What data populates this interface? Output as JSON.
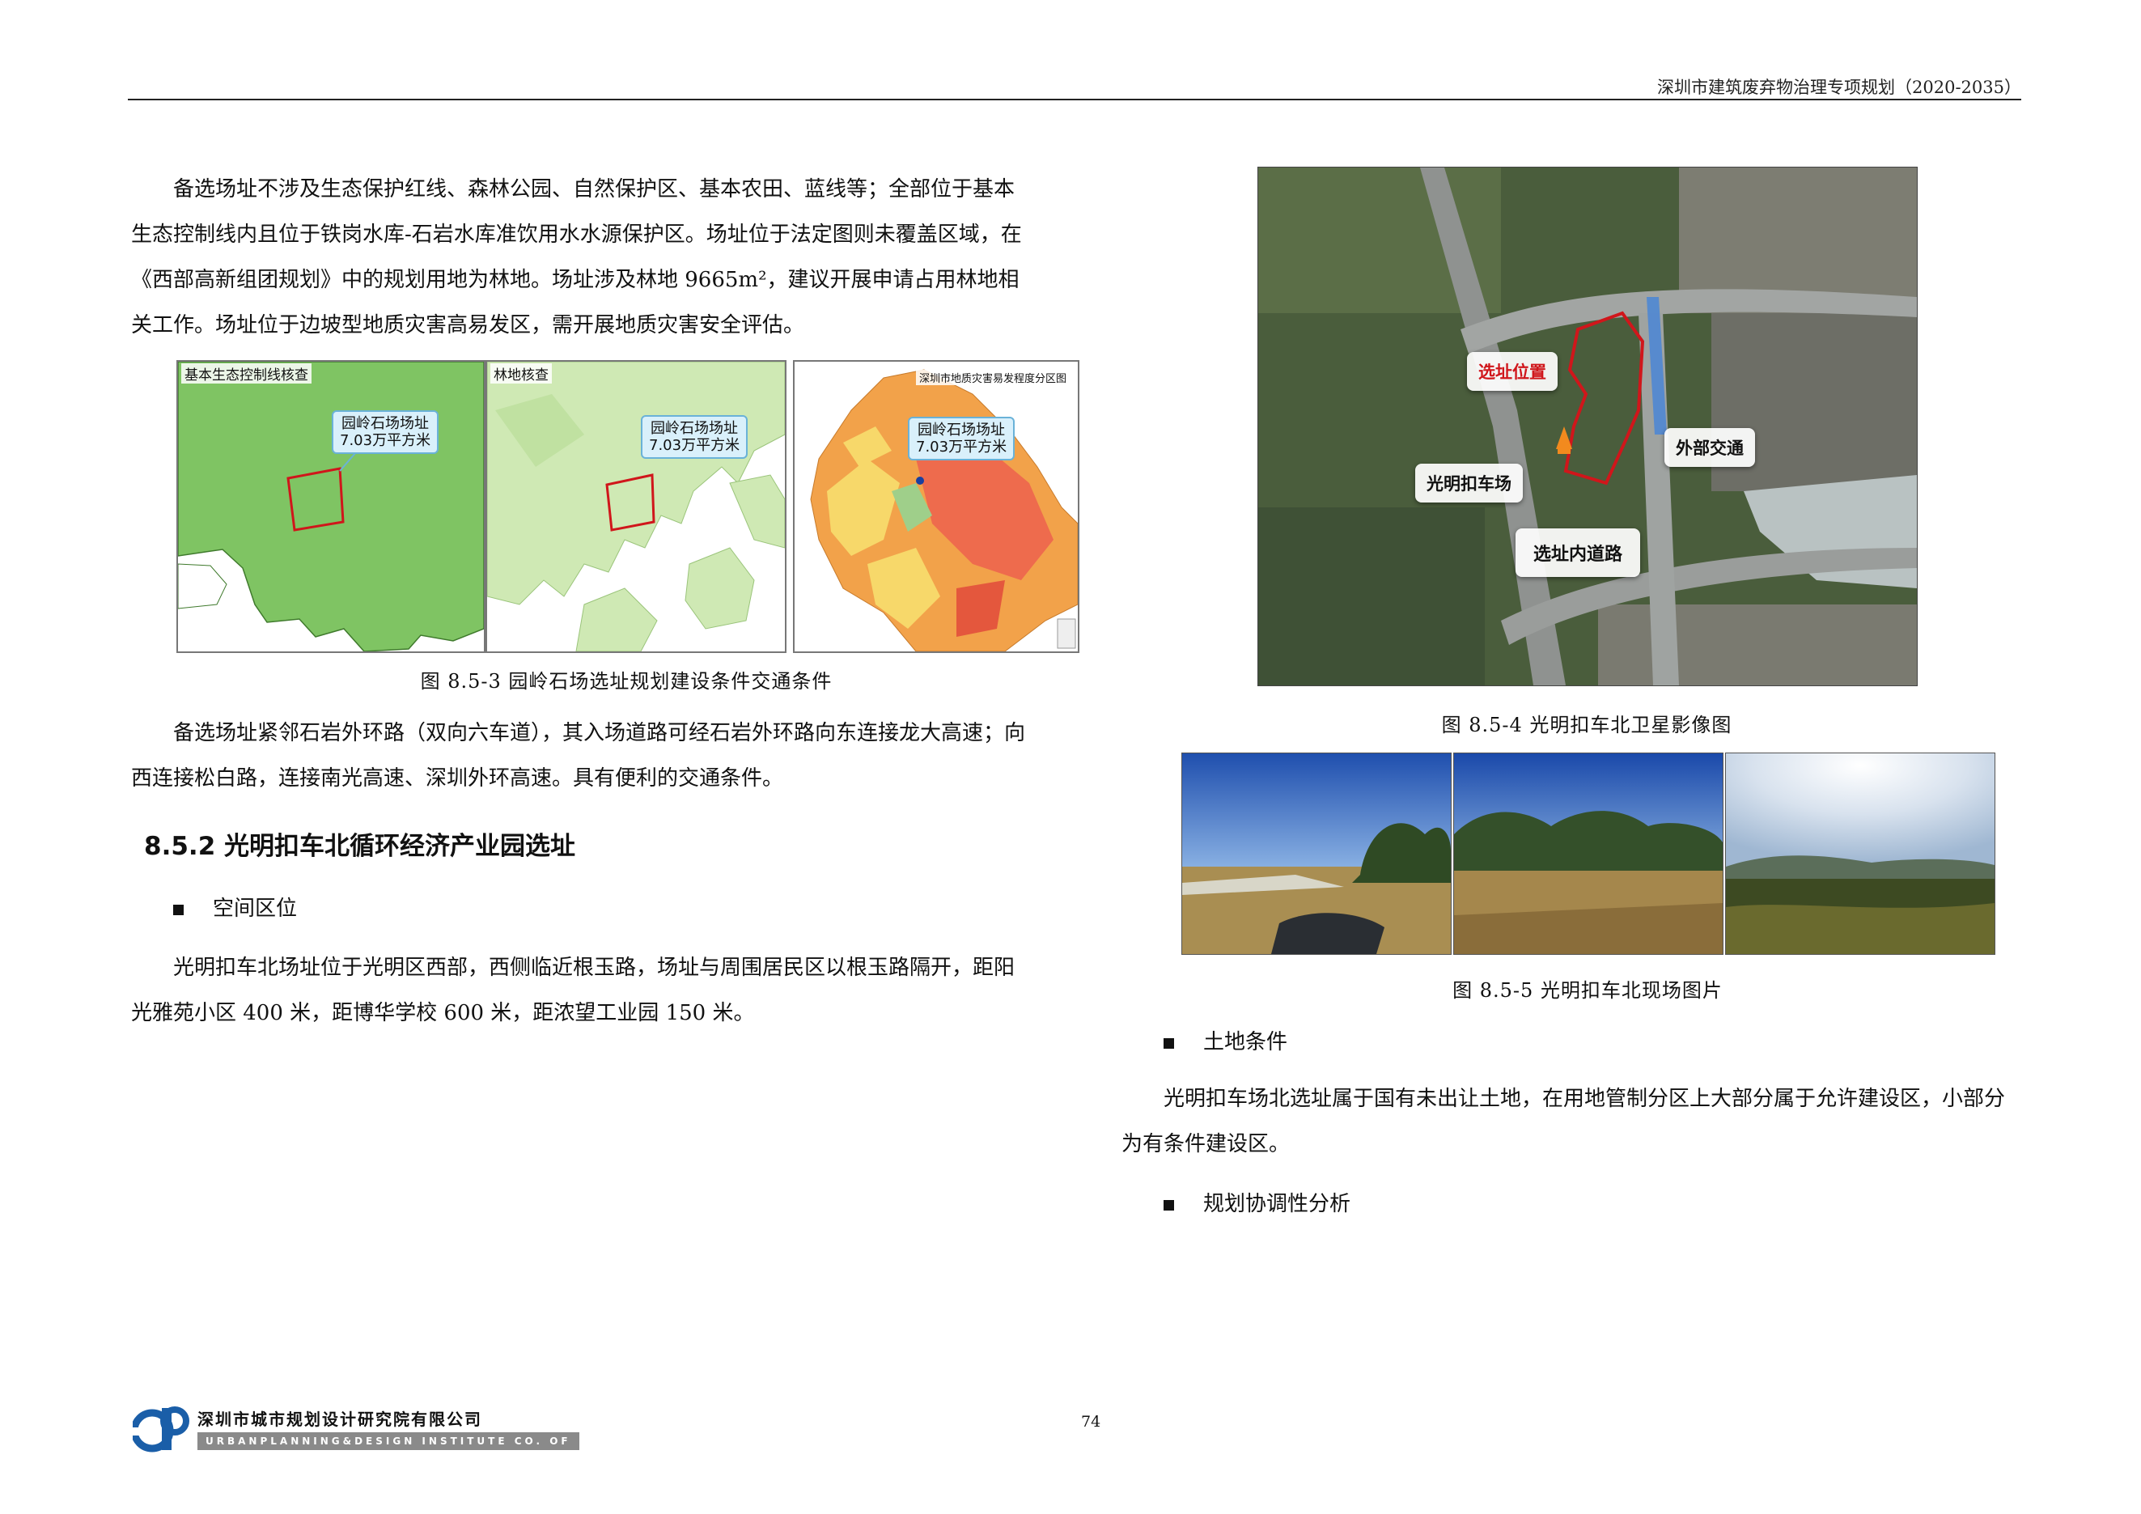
{
  "header": {
    "title": "深圳市建筑废弃物治理专项规划（2020-2035）"
  },
  "left": {
    "para1": "备选场址不涉及生态保护红线、森林公园、自然保护区、基本农田、蓝线等；全部位于基本生态控制线内且位于铁岗水库-石岩水库准饮用水水源保护区。场址位于法定图则未覆盖区域，在《西部高新组团规划》中的规划用地为林地。场址涉及林地 9665m²，建议开展申请占用林地相关工作。场址位于边坡型地质灾害高易发区，需开展地质灾害安全评估。",
    "panels": [
      {
        "title": "基本生态控制线核查",
        "callout_line1": "园岭石场场址",
        "callout_line2": "7.03万平方米"
      },
      {
        "title": "林地核查",
        "callout_line1": "园岭石场场址",
        "callout_line2": "7.03万平方米"
      },
      {
        "title": "深圳市地质灾害易发程度分区图",
        "callout_line1": "园岭石场场址",
        "callout_line2": "7.03万平方米"
      }
    ],
    "fig_caption": "图 8.5-3 园岭石场选址规划建设条件交通条件",
    "para2": "备选场址紧邻石岩外环路（双向六车道），其入场道路可经石岩外环路向东连接龙大高速；向西连接松白路，连接南光高速、深圳外环高速。具有便利的交通条件。",
    "section_title": "8.5.2 光明扣车北循环经济产业园选址",
    "bullet1": "空间区位",
    "para3": "光明扣车北场址位于光明区西部，西侧临近根玉路，场址与周围居民区以根玉路隔开，距阳光雅苑小区 400 米，距博华学校 600 米，距浓望工业园 150 米。"
  },
  "right": {
    "satellite_labels": {
      "site": "选址位置",
      "external": "外部交通",
      "yard": "光明扣车场",
      "internal": "选址内道路"
    },
    "fig4_caption": "图 8.5-4 光明扣车北卫星影像图",
    "fig5_caption": "图 8.5-5 光明扣车北现场图片",
    "bullet2": "土地条件",
    "para4": "光明扣车场北选址属于国有未出让土地，在用地管制分区上大部分属于允许建设区，小部分为有条件建设区。",
    "bullet3": "规划协调性分析"
  },
  "footer": {
    "org_name": "深圳市城市规划设计研究院有限公司",
    "org_name_en": "URBANPLANNING&DESIGN INSTITUTE CO. OF SHENZHEN",
    "page_number": "74"
  },
  "colors": {
    "site_outline": "#d0161b",
    "ecology_green": "#7fc463",
    "callout_fill": "#d9f0fb",
    "logo_blue": "#1a5ea8"
  }
}
